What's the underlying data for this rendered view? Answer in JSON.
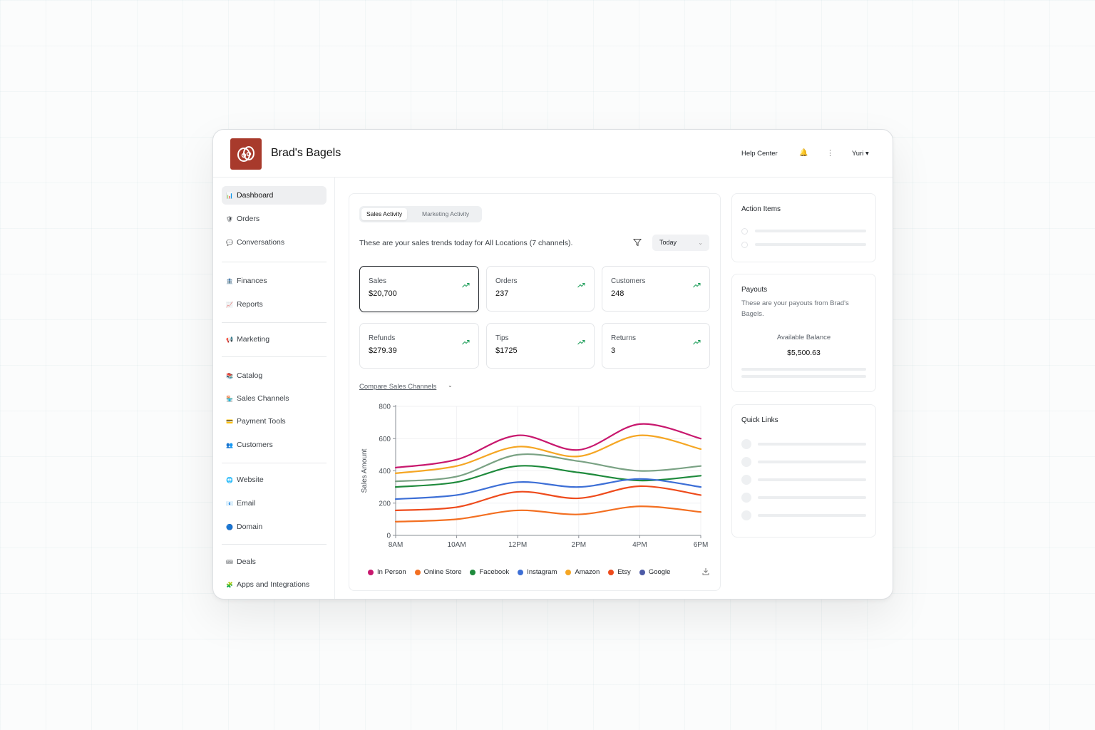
{
  "header": {
    "brand": "Brad's Bagels",
    "help_center": "Help Center",
    "bell_icon": "🔔",
    "more_icon": "⋮",
    "user_label": "Yuri ▾"
  },
  "sidebar": {
    "items": [
      {
        "label": "Dashboard",
        "icon": "📊"
      },
      {
        "label": "Orders",
        "icon": "🛡"
      },
      {
        "label": "Conversations",
        "icon": "💬"
      },
      {
        "label": "Finances",
        "icon": "🏦"
      },
      {
        "label": "Reports",
        "icon": "📈"
      },
      {
        "label": "Marketing",
        "icon": "📢"
      },
      {
        "label": "Catalog",
        "icon": "📚"
      },
      {
        "label": "Sales Channels",
        "icon": "🏪"
      },
      {
        "label": "Payment Tools",
        "icon": "💳"
      },
      {
        "label": "Customers",
        "icon": "👥"
      },
      {
        "label": "Website",
        "icon": "🌐"
      },
      {
        "label": "Email",
        "icon": "📧"
      },
      {
        "label": "Domain",
        "icon": "🔵"
      },
      {
        "label": "Deals",
        "icon": "🎟"
      },
      {
        "label": "Apps and Integrations",
        "icon": "🧩"
      }
    ]
  },
  "main": {
    "tabs": [
      "Sales Activity",
      "Marketing Activity"
    ],
    "description": "These are your sales trends today for All Locations (7 channels).",
    "date_filter": "Today",
    "compare_label": "Compare Sales Channels",
    "metrics": [
      {
        "label": "Sales",
        "value": "$20,700"
      },
      {
        "label": "Orders",
        "value": "237"
      },
      {
        "label": "Customers",
        "value": "248"
      },
      {
        "label": "Refunds",
        "value": "$279.39"
      },
      {
        "label": "Tips",
        "value": "$1725"
      },
      {
        "label": "Returns",
        "value": "3"
      }
    ]
  },
  "chart_data": {
    "type": "line",
    "x": [
      "8AM",
      "10AM",
      "12PM",
      "2PM",
      "4PM",
      "6PM"
    ],
    "ylabel": "Sales Amount",
    "ylim": [
      0,
      800
    ],
    "yticks": [
      0,
      200,
      400,
      600,
      800
    ],
    "grid": true,
    "legend": "bottom",
    "series": [
      {
        "name": "In Person",
        "color": "#c8186e",
        "values": [
          420,
          470,
          620,
          530,
          690,
          600
        ]
      },
      {
        "name": "Online Store",
        "color": "#f36f21",
        "values": [
          85,
          100,
          155,
          130,
          180,
          145
        ]
      },
      {
        "name": "Facebook",
        "color": "#1e8a3c",
        "values": [
          300,
          330,
          430,
          390,
          340,
          370
        ]
      },
      {
        "name": "Instagram",
        "color": "#3d6fd6",
        "values": [
          225,
          250,
          330,
          300,
          350,
          300
        ]
      },
      {
        "name": "Amazon",
        "color": "#f5a623",
        "values": [
          385,
          430,
          550,
          490,
          620,
          535
        ]
      },
      {
        "name": "Etsy",
        "color": "#ee4b1c",
        "values": [
          155,
          175,
          270,
          230,
          305,
          250
        ]
      },
      {
        "name": "Google",
        "color": "#4c5aa6",
        "values": null
      },
      {
        "name": "",
        "color": "#7aa284",
        "values": [
          335,
          365,
          500,
          460,
          400,
          430
        ]
      }
    ]
  },
  "action_items": {
    "title": "Action Items"
  },
  "payouts": {
    "title": "Payouts",
    "description": "These are your payouts from Brad's Bagels.",
    "balance_label": "Available Balance",
    "balance_value": "$5,500.63"
  },
  "quick_links": {
    "title": "Quick Links"
  }
}
